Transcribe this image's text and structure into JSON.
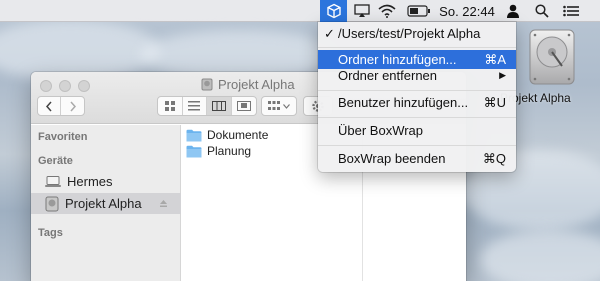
{
  "menubar": {
    "clock": "So. 22:44",
    "icons": [
      "boxwrap-cube-icon",
      "airplay-icon",
      "wifi-icon",
      "battery-icon",
      "user-icon",
      "spotlight-search-icon",
      "notification-list-icon"
    ],
    "accent": "#2b75dd"
  },
  "desktop": {
    "drive_label": "Projekt Alpha",
    "drive_icon": "hard-drive-icon"
  },
  "finder": {
    "title": "Projekt Alpha",
    "sidebar": {
      "favorites_header": "Favoriten",
      "devices_header": "Geräte",
      "tags_header": "Tags",
      "devices": [
        {
          "label": "Hermes",
          "icon": "laptop-icon"
        },
        {
          "label": "Projekt Alpha",
          "icon": "disk-icon",
          "selected": true
        }
      ]
    },
    "files": [
      {
        "name": "Dokumente",
        "icon": "folder-icon"
      },
      {
        "name": "Planung",
        "icon": "folder-icon"
      }
    ]
  },
  "menu": {
    "check_mark": "✓",
    "path_item": "/Users/test/Projekt Alpha",
    "items": [
      {
        "label": "Ordner hinzufügen...",
        "shortcut": "⌘A",
        "highlighted": true
      },
      {
        "label": "Ordner entfernen",
        "shortcut": "▶"
      },
      {
        "label": "Benutzer hinzufügen...",
        "shortcut": "⌘U"
      },
      {
        "label": "Über BoxWrap",
        "shortcut": ""
      },
      {
        "label": "BoxWrap beenden",
        "shortcut": "⌘Q"
      }
    ],
    "highlight_color": "#2d6fdb"
  }
}
